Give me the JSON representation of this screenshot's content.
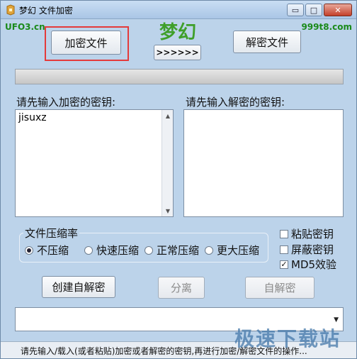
{
  "window": {
    "title": "梦幻 文件加密",
    "controls": {
      "minimize": "▭",
      "maximize": "□",
      "close": "✕"
    }
  },
  "header": {
    "brand_left": "UFO3.cn",
    "brand_right": "999t8.com",
    "logo_text": "梦幻"
  },
  "toolbar": {
    "encrypt_file": "加密文件",
    "arrow_button": ">>>>>>",
    "decrypt_file": "解密文件"
  },
  "progress": {
    "value": 0
  },
  "encrypt_key": {
    "label": "请先输入加密的密钥:",
    "value": "jisuxz"
  },
  "decrypt_key": {
    "label": "请先输入解密的密钥:",
    "value": ""
  },
  "compression": {
    "title": "文件压缩率",
    "options": [
      {
        "label": "不压缩",
        "selected": true
      },
      {
        "label": "快速压缩",
        "selected": false
      },
      {
        "label": "正常压缩",
        "selected": false
      },
      {
        "label": "更大压缩",
        "selected": false
      }
    ]
  },
  "options": {
    "paste_key": {
      "label": "粘贴密钥",
      "checked": false
    },
    "mask_key": {
      "label": "屏蔽密钥",
      "checked": false
    },
    "md5_verify": {
      "label": "MD5效验",
      "checked": true
    }
  },
  "actions": {
    "create_self_decrypt": "创建自解密",
    "split": "分离",
    "self_decrypt": "自解密"
  },
  "dropdown": {
    "value": ""
  },
  "status": {
    "text": "请先输入/载入(或者粘贴)加密或者解密的密钥,再进行加密/解密文件的操作..."
  },
  "watermark": {
    "text": "极速下载站"
  },
  "colors": {
    "window_bg": "#bcd3ea",
    "logo_green": "#3f9f2a",
    "highlight_red": "#e43b3b"
  }
}
